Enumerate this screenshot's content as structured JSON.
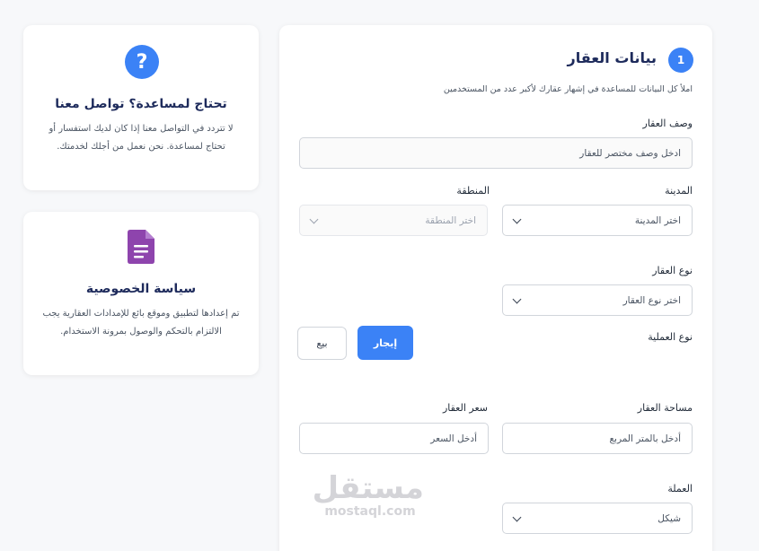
{
  "help_card": {
    "title": "تحتاج لمساعدة؟ تواصل معنا",
    "text": "لا تتردد في التواصل معنا إذا كان لديك استفسار أو تحتاج لمساعدة. نحن نعمل من أجلك لخدمتك."
  },
  "privacy_card": {
    "title": "سياسة الخصوصية",
    "text": "تم إعدادها لتطبيق وموقع بائع للإمدادات العقارية يجب الالتزام بالتحكم والوصول بمرونة الاستخدام."
  },
  "form": {
    "step_number": "1",
    "title": "بيانات العقار",
    "subtitle": "املأ كل البيانات للمساعدة في إشهار عقارك لأكبر عدد من المستخدمين",
    "description": {
      "label": "وصف العقار",
      "placeholder": "ادخل وصف مختصر للعقار"
    },
    "city": {
      "label": "المدينة",
      "value": "اختر المدينة"
    },
    "region": {
      "label": "المنطقة",
      "value": "اختر المنطقة"
    },
    "property_type": {
      "label": "نوع العقار",
      "value": "اختر نوع العقار"
    },
    "operation_type": {
      "label": "نوع العملية",
      "options": [
        "إيجار",
        "بيع"
      ],
      "selected": "إيجار"
    },
    "area": {
      "label": "مساحة العقار",
      "placeholder": "أدخل بالمتر المربع"
    },
    "price": {
      "label": "سعر العقار",
      "placeholder": "أدخل السعر"
    },
    "currency": {
      "label": "العملة",
      "value": "شيكل"
    }
  },
  "watermark": {
    "arabic": "مستقل",
    "latin": "mostaql.com"
  },
  "colors": {
    "accent": "#3b82f6",
    "title": "#1e2b5c",
    "privacy_icon": "#8e44ad"
  }
}
